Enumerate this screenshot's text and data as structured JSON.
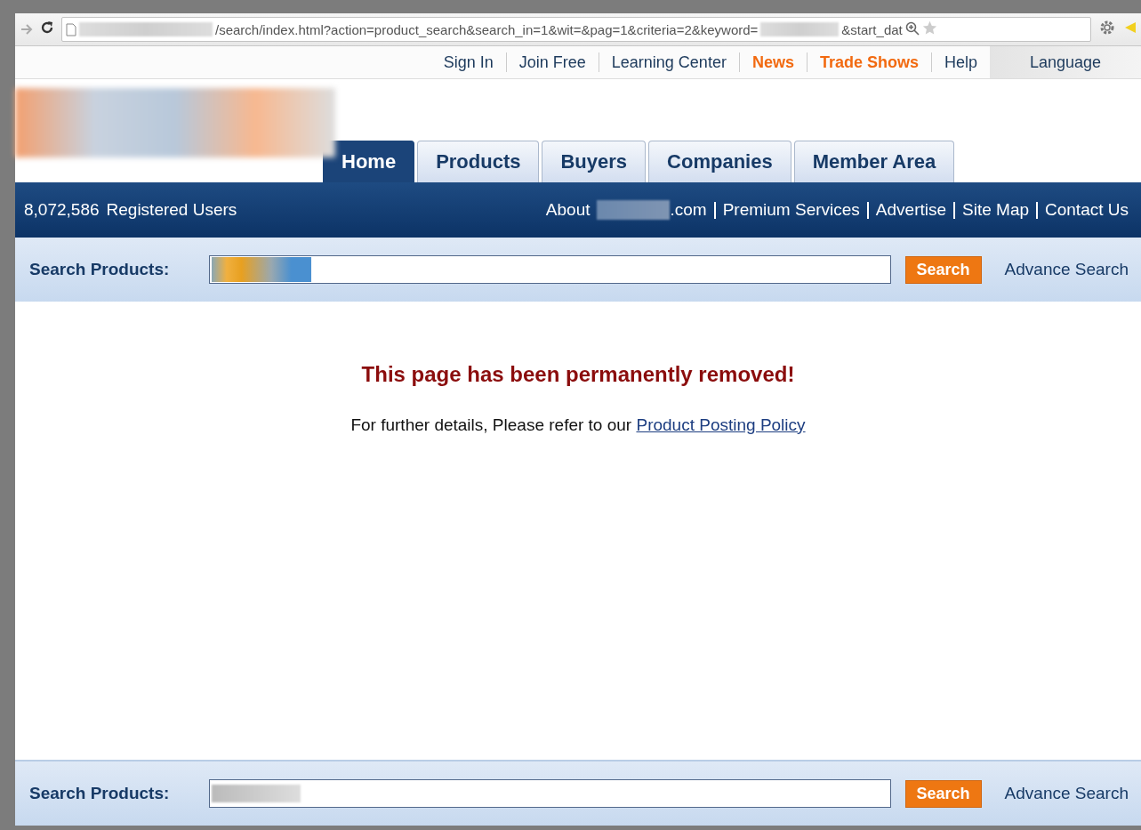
{
  "browser": {
    "url_parts": [
      "/search/index.html?action=product_search&search_in=1&wit=&pag=1&criteria=2&keyword=",
      "&start_dat"
    ]
  },
  "top_links": [
    {
      "label": "Sign In",
      "kind": "plain"
    },
    {
      "label": "Join Free",
      "kind": "plain"
    },
    {
      "label": "Learning Center",
      "kind": "plain"
    },
    {
      "label": "News",
      "kind": "highlight"
    },
    {
      "label": "Trade Shows",
      "kind": "highlight"
    },
    {
      "label": "Help",
      "kind": "plain"
    }
  ],
  "language": "Language",
  "tabs": [
    {
      "label": "Home",
      "selected": true
    },
    {
      "label": "Products",
      "selected": false
    },
    {
      "label": "Buyers",
      "selected": false
    },
    {
      "label": "Companies",
      "selected": false
    },
    {
      "label": "Member Area",
      "selected": false
    }
  ],
  "info_bar": {
    "user_count": "8,072,586",
    "user_label": "Registered Users",
    "about_prefix": "About",
    "about_suffix": ".com",
    "links": [
      "Premium Services",
      "Advertise",
      "Site Map",
      "Contact Us"
    ]
  },
  "search_bars": [
    {
      "label": "Search Products:",
      "button": "Search",
      "advanced": "Advance Search",
      "kind": "colored"
    },
    {
      "label": "Search Products:",
      "button": "Search",
      "advanced": "Advance Search",
      "kind": "gray"
    }
  ],
  "message": {
    "title": "This page has been permanently removed!",
    "text": "For further details, Please refer to our",
    "link": "Product Posting Policy"
  }
}
